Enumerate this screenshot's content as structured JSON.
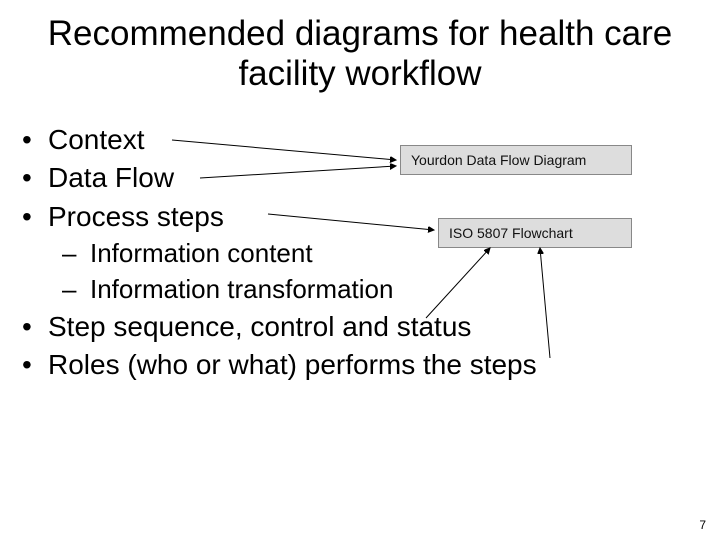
{
  "title": "Recommended diagrams for health care facility workflow",
  "bullets": {
    "b1": "Context",
    "b2": "Data Flow",
    "b3": "Process steps",
    "b3a": "Information content",
    "b3b": "Information transformation",
    "b4": "Step sequence, control and status",
    "b5": "Roles (who or what) performs the steps"
  },
  "callout1": "Yourdon Data Flow Diagram",
  "callout2": "ISO 5807 Flowchart",
  "pagenum": "7"
}
